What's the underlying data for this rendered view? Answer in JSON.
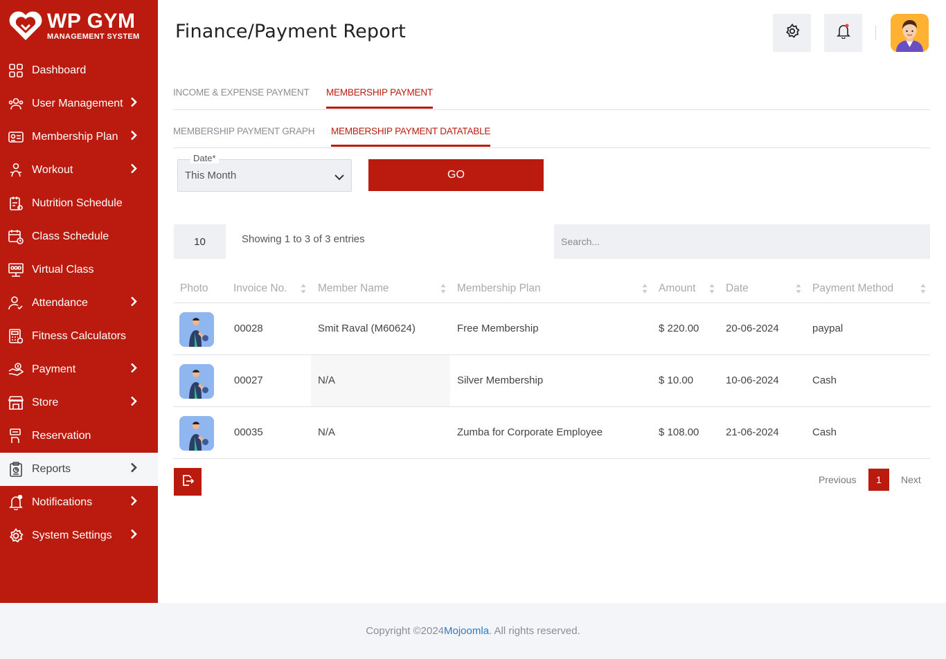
{
  "brand": {
    "title": "WP GYM",
    "subtitle": "MANAGEMENT SYSTEM"
  },
  "sidebar": {
    "items": [
      {
        "label": "Dashboard",
        "icon": "dashboard-icon",
        "has_submenu": false
      },
      {
        "label": "User Management",
        "icon": "users-icon",
        "has_submenu": true
      },
      {
        "label": "Membership Plan",
        "icon": "membership-card-icon",
        "has_submenu": true
      },
      {
        "label": "Workout",
        "icon": "workout-icon",
        "has_submenu": true
      },
      {
        "label": "Nutrition Schedule",
        "icon": "nutrition-icon",
        "has_submenu": false
      },
      {
        "label": "Class Schedule",
        "icon": "calendar-icon",
        "has_submenu": false
      },
      {
        "label": "Virtual Class",
        "icon": "virtual-class-icon",
        "has_submenu": false
      },
      {
        "label": "Attendance",
        "icon": "attendance-icon",
        "has_submenu": true
      },
      {
        "label": "Fitness Calculators",
        "icon": "calculator-icon",
        "has_submenu": false
      },
      {
        "label": "Payment",
        "icon": "payment-icon",
        "has_submenu": true
      },
      {
        "label": "Store",
        "icon": "store-icon",
        "has_submenu": true
      },
      {
        "label": "Reservation",
        "icon": "reservation-icon",
        "has_submenu": false
      },
      {
        "label": "Reports",
        "icon": "reports-icon",
        "has_submenu": true,
        "active": true
      },
      {
        "label": "Notifications",
        "icon": "bell-icon",
        "has_submenu": true
      },
      {
        "label": "System Settings",
        "icon": "gear-icon",
        "has_submenu": true
      }
    ]
  },
  "header": {
    "title": "Finance/Payment Report"
  },
  "tabs_primary": [
    "INCOME & EXPENSE PAYMENT",
    "MEMBERSHIP PAYMENT"
  ],
  "tabs_secondary": [
    "MEMBERSHIP PAYMENT GRAPH",
    "MEMBERSHIP PAYMENT DATATABLE"
  ],
  "filter": {
    "date_label": "Date*",
    "date_value": "This Month",
    "go_label": "GO"
  },
  "table_controls": {
    "page_length": "10",
    "showing": "Showing 1 to 3 of 3 entries",
    "search_placeholder": "Search..."
  },
  "table": {
    "columns": [
      "Photo",
      "Invoice No.",
      "Member Name",
      "Membership Plan",
      "Amount",
      "Date",
      "Payment Method"
    ],
    "rows": [
      {
        "invoice": "00028",
        "member": "Smit Raval (M60624)",
        "plan": "Free Membership",
        "amount": "$ 220.00",
        "date": "20-06-2024",
        "method": "paypal"
      },
      {
        "invoice": "00027",
        "member": "N/A",
        "plan": "Silver Membership",
        "amount": "$ 10.00",
        "date": "10-06-2024",
        "method": "Cash"
      },
      {
        "invoice": "00035",
        "member": "N/A",
        "plan": "Zumba for Corporate Employee",
        "amount": "$ 108.00",
        "date": "21-06-2024",
        "method": "Cash"
      }
    ]
  },
  "pagination": {
    "previous": "Previous",
    "current": "1",
    "next": "Next"
  },
  "footer": {
    "prefix": "Copyright ©2024 ",
    "link": "Mojoomla",
    "suffix": ". All rights reserved."
  },
  "colors": {
    "brand_red": "#bb1b0f",
    "muted_bg": "#eef0f3",
    "link_blue": "#2c79c4"
  }
}
